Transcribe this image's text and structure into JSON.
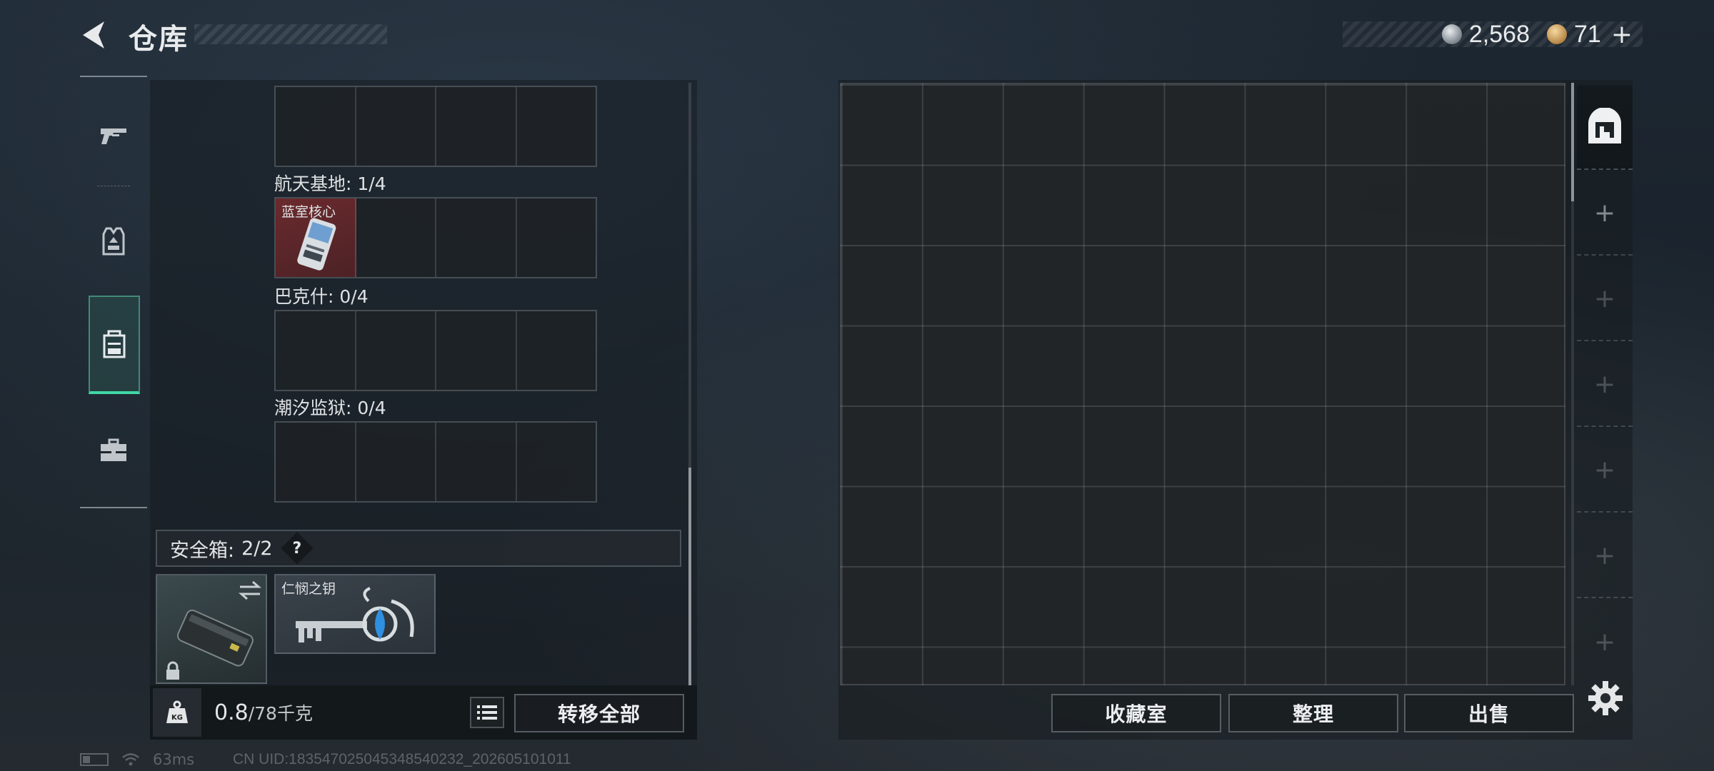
{
  "header": {
    "title": "仓库"
  },
  "currency": [
    {
      "icon": "silver-coin-icon",
      "value": "2,568"
    },
    {
      "icon": "gold-coin-icon",
      "value": "71"
    }
  ],
  "currency_add": "+",
  "sidebar": {
    "items": [
      {
        "icon": "pistol-icon"
      },
      {
        "icon": "armor-vest-icon"
      },
      {
        "icon": "backpack-icon",
        "active": true
      },
      {
        "icon": "toolbox-icon"
      }
    ]
  },
  "left_panel": {
    "sections": [
      {
        "label": "航天基地: 1/4",
        "item": "蓝室核心"
      },
      {
        "label": "巴克什: 0/4"
      },
      {
        "label": "潮汐监狱: 0/4"
      }
    ],
    "safe_box": {
      "label": "安全箱:",
      "count": "2/2",
      "help": "?"
    },
    "key_item": "仁悯之钥",
    "weight": {
      "current": "0.8",
      "capacity": "/78千克"
    },
    "transfer_all": "转移全部"
  },
  "right_panel": {
    "slot_add": "+",
    "buttons": {
      "collection": "收藏室",
      "organize": "整理",
      "sell": "出售"
    }
  },
  "status": {
    "ping": "63ms",
    "uid": "CN UID:183547025045348540232_202605101011"
  },
  "colors": {
    "accent": "#3fd8a5",
    "item_red": "#6a2a2d"
  }
}
